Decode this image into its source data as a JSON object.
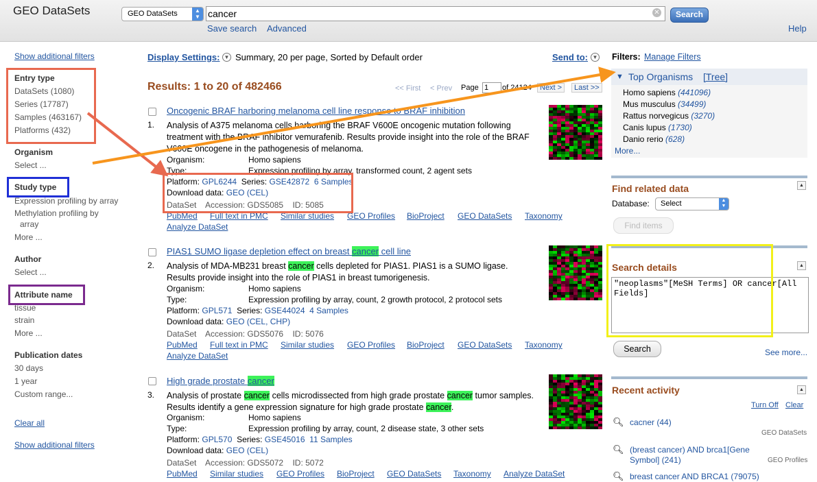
{
  "header": {
    "app_title": "GEO DataSets",
    "db_selected": "GEO DataSets",
    "search_value": "cancer",
    "search_button": "Search",
    "save_search": "Save search",
    "advanced": "Advanced",
    "help": "Help"
  },
  "left": {
    "show_filters_top": "Show additional filters",
    "entry_type": {
      "heading": "Entry type",
      "items": [
        "DataSets (1080)",
        "Series (17787)",
        "Samples (463167)",
        "Platforms (432)"
      ]
    },
    "organism": {
      "heading": "Organism",
      "items": [
        "Select ..."
      ]
    },
    "study_type": {
      "heading": "Study type",
      "items": [
        "Expression profiling by array",
        "Methylation profiling by",
        "array",
        "More ..."
      ]
    },
    "author": {
      "heading": "Author",
      "items": [
        "Select ..."
      ]
    },
    "attribute_name": {
      "heading": "Attribute name",
      "items": [
        "tissue",
        "strain",
        "More ..."
      ]
    },
    "pub_dates": {
      "heading": "Publication dates",
      "items": [
        "30 days",
        "1 year",
        "Custom range..."
      ]
    },
    "clear_all": "Clear all",
    "show_filters_bottom": "Show additional filters"
  },
  "display": {
    "settings_label": "Display Settings:",
    "settings_value": "Summary, 20 per page, Sorted by Default order",
    "send_to": "Send to:",
    "results_count": "Results: 1 to 20 of 482466",
    "first": "<< First",
    "prev": "< Prev",
    "page_label": "Page",
    "page_value": "1",
    "of_pages": "of 24124",
    "next": "Next >",
    "last": "Last >>"
  },
  "results": [
    {
      "num": "1.",
      "title_pre": "Oncogenic BRAF harboring melanoma cell line response to BRAF inhibition",
      "title_hl": "",
      "title_post": "",
      "desc": "Analysis of A375 melanoma cells harboring the BRAF V600E oncogenic mutation following treatment with the BRAF inhibitor vemurafenib. Results provide insight into the role of the BRAF V600E oncogene in the pathogenesis of melanoma.",
      "organism_label": "Organism:",
      "organism": "Homo sapiens",
      "type_label": "Type:",
      "type": "Expression profiling by array, transformed count, 2 agent sets",
      "platform_label": "Platform:",
      "platform": "GPL6244",
      "series_label": "Series:",
      "series": "GSE42872",
      "samples": "6 Samples",
      "download_label": "Download data:",
      "download": "GEO (CEL)",
      "dataset_label": "DataSet",
      "accession": "Accession: GDS5085",
      "id": "ID: 5085",
      "links": [
        "PubMed",
        "Full text in PMC",
        "Similar studies",
        "GEO Profiles",
        "BioProject",
        "GEO DataSets",
        "Taxonomy"
      ],
      "links2": [
        "Analyze DataSet"
      ]
    },
    {
      "num": "2.",
      "title_pre": "PIAS1 SUMO ligase depletion effect on breast ",
      "title_hl": "cancer",
      "title_post": " cell line",
      "desc_parts": [
        "Analysis of MDA-MB231 breast ",
        "cancer",
        " cells depleted for PIAS1. PIAS1 is a SUMO ligase. Results provide insight into the role of PIAS1 in breast tumorigenesis."
      ],
      "organism_label": "Organism:",
      "organism": "Homo sapiens",
      "type_label": "Type:",
      "type": "Expression profiling by array, count, 2 growth protocol, 2 protocol sets",
      "platform_label": "Platform:",
      "platform": "GPL571",
      "series_label": "Series:",
      "series": "GSE44024",
      "samples": "4 Samples",
      "download_label": "Download data:",
      "download": "GEO (CEL, CHP)",
      "dataset_label": "DataSet",
      "accession": "Accession: GDS5076",
      "id": "ID: 5076",
      "links": [
        "PubMed",
        "Full text in PMC",
        "Similar studies",
        "GEO Profiles",
        "BioProject",
        "GEO DataSets",
        "Taxonomy"
      ],
      "links2": [
        "Analyze DataSet"
      ]
    },
    {
      "num": "3.",
      "title_pre": "High grade prostate ",
      "title_hl": "cancer",
      "title_post": "",
      "desc_parts": [
        "Analysis of prostate ",
        "cancer",
        " cells microdissected from high grade prostate ",
        "cancer",
        " tumor samples. Results identify a gene expression signature for high grade prostate ",
        "cancer",
        "."
      ],
      "organism_label": "Organism:",
      "organism": "Homo sapiens",
      "type_label": "Type:",
      "type": "Expression profiling by array, count, 2 disease state, 3 other sets",
      "platform_label": "Platform:",
      "platform": "GPL570",
      "series_label": "Series:",
      "series": "GSE45016",
      "samples": "11 Samples",
      "download_label": "Download data:",
      "download": "GEO (CEL)",
      "dataset_label": "DataSet",
      "accession": "Accession: GDS5072",
      "id": "ID: 5072",
      "links": [
        "PubMed",
        "Similar studies",
        "GEO Profiles",
        "BioProject",
        "GEO DataSets",
        "Taxonomy",
        "Analyze DataSet"
      ]
    }
  ],
  "right": {
    "filters_label": "Filters:",
    "manage_filters": "Manage Filters",
    "top_organisms": "Top Organisms",
    "tree": "[Tree]",
    "organisms": [
      {
        "name": "Homo sapiens",
        "count": "(441096)"
      },
      {
        "name": "Mus musculus",
        "count": "(34499)"
      },
      {
        "name": "Rattus norvegicus",
        "count": "(3270)"
      },
      {
        "name": "Canis lupus",
        "count": "(1730)"
      },
      {
        "name": "Danio rerio",
        "count": "(628)"
      }
    ],
    "more": "More...",
    "find_related": "Find related data",
    "database_label": "Database:",
    "database_value": "Select",
    "find_items": "Find items",
    "search_details": "Search details",
    "query": "\"neoplasms\"[MeSH Terms] OR cancer[All Fields]",
    "search_btn": "Search",
    "see_more": "See more...",
    "recent_activity": "Recent activity",
    "turn_off": "Turn Off",
    "clear": "Clear",
    "activity": [
      {
        "query": "cacner (44)",
        "db": "GEO DataSets"
      },
      {
        "query": "(breast cancer) AND brca1[Gene Symbol] (241)",
        "db": "GEO Profiles"
      },
      {
        "query": "breast cancer AND BRCA1 (79075)",
        "db": ""
      }
    ]
  },
  "colors": {
    "link": "#2255a0",
    "results_count": "#994c1f",
    "highlight": "#3df25a",
    "annot_red": "#e8694f",
    "annot_blue": "#1f2fd6",
    "annot_purple": "#7b2a8e",
    "annot_yellow": "#f2f01a",
    "annot_arrow_orange": "#f7951d"
  }
}
